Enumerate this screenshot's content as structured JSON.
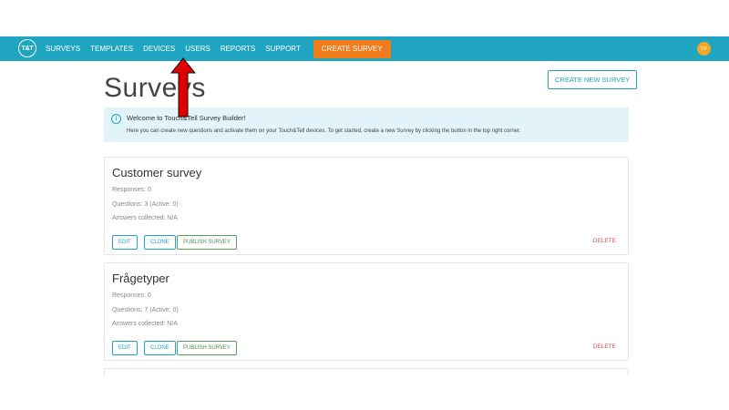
{
  "app": {
    "logo_text": "T&T",
    "avatar_initials": "DP"
  },
  "nav": {
    "items": [
      {
        "label": "SURVEYS"
      },
      {
        "label": "TEMPLATES"
      },
      {
        "label": "DEVICES"
      },
      {
        "label": "USERS"
      },
      {
        "label": "REPORTS"
      },
      {
        "label": "SUPPORT"
      }
    ],
    "cta_label": "CREATE SURVEY"
  },
  "page": {
    "title": "Surveys",
    "create_new_label": "CREATE NEW SURVEY"
  },
  "info": {
    "title": "Welcome to Touch&Tell Survey Builder!",
    "body": "Here you can create new questions and activate them on your Touch&Tell devices. To get started, create a new Survey by clicking the button in the top right corner."
  },
  "surveys": [
    {
      "title": "Customer survey",
      "responses": "Responses: 0",
      "questions": "Questions: 3 (Active: 0)",
      "answers": "Answers collected: N/A",
      "edit_label": "EDIT",
      "clone_label": "CLONE",
      "publish_label": "PUBLISH SURVEY",
      "delete_label": "DELETE"
    },
    {
      "title": "Frågetyper",
      "responses": "Responses: 0",
      "questions": "Questions: 7 (Active: 0)",
      "answers": "Answers collected: N/A",
      "edit_label": "EDIT",
      "clone_label": "CLONE",
      "publish_label": "PUBLISH SURVEY",
      "delete_label": "DELETE"
    }
  ],
  "colors": {
    "brand": "#1fa5c1",
    "accent": "#f07b1a",
    "delete": "#d9534f",
    "publish": "#4d8c4d",
    "annotation_arrow": "#e00000"
  },
  "icons": {
    "info": "info-circle-icon",
    "annotation": "up-arrow-icon"
  }
}
